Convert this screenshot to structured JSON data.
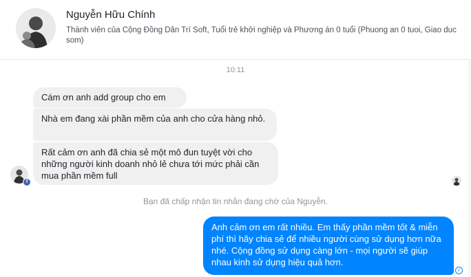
{
  "header": {
    "name": "Nguyễn Hữu Chính",
    "subtitle": "Thành viên của Cộng Đồng Dân Trí Soft, Tuổi trẻ khởi nghiệp và Phương án 0 tuổi (Phuong an 0 tuoi, Giao duc som)"
  },
  "timestamp": "10:11",
  "incoming_messages": [
    "Cám ơn anh add group cho em",
    "Nhà em đang xài phần mềm của anh cho cửa hàng nhỏ.",
    "Rất cảm ơn anh đã chia sẻ một mô đun tuyệt vời cho những người kinh doanh nhỏ lẻ chưa tới mức phải cần mua phần mềm full"
  ],
  "system_note": "Bạn đã chấp nhận tin nhắn đang chờ của Nguyễn.",
  "outgoing_message": "Anh cảm ơn em rất nhiều. Em thấy phần mềm tốt & miễn phí thì hãy chia sẻ để nhiều người cùng sử dụng hơn nữa nhé. Cộng đồng sử dụng càng lớn - mọi người sẽ giúp nhau kinh sử dụng hiệu quả hơn.",
  "colors": {
    "incoming_bubble": "#f1f0f0",
    "outgoing_bubble": "#0084ff",
    "muted_text": "#90949c"
  },
  "icons": {
    "avatar_badge": "facebook-badge-icon",
    "sent_status": "sent-check-icon"
  }
}
